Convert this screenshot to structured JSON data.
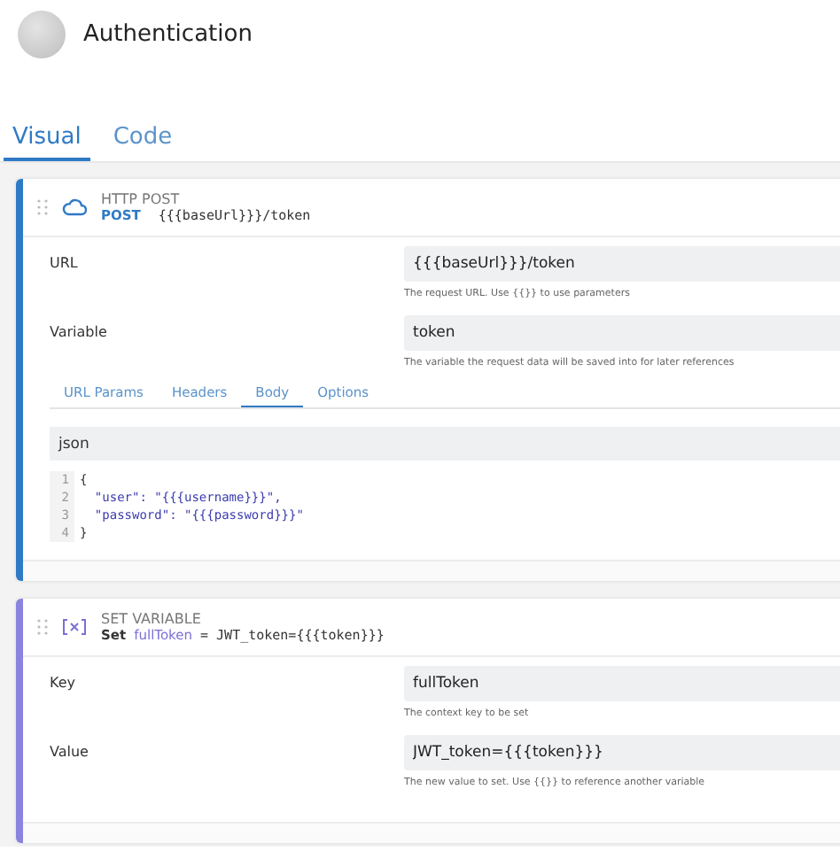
{
  "header": {
    "title": "Authentication"
  },
  "view_tabs": [
    {
      "label": "Visual",
      "selected": true
    },
    {
      "label": "Code",
      "selected": false
    }
  ],
  "steps": [
    {
      "kind": "http",
      "type_label": "HTTP POST",
      "summary": {
        "method": "POST",
        "path": "{{{baseUrl}}}/token"
      },
      "fields": [
        {
          "label": "URL",
          "value": "{{{baseUrl}}}/token",
          "hint": "The request URL. Use {{}} to use parameters"
        },
        {
          "label": "Variable",
          "value": "token",
          "hint": "The variable the request data will be saved into for later references"
        }
      ],
      "request_tabs": [
        {
          "label": "URL Params",
          "selected": false
        },
        {
          "label": "Headers",
          "selected": false
        },
        {
          "label": "Body",
          "selected": true
        },
        {
          "label": "Options",
          "selected": false
        }
      ],
      "body": {
        "format": "json",
        "lines": [
          {
            "number": "1",
            "text": "{",
            "kind": "brace"
          },
          {
            "number": "2",
            "text": "  \"user\": \"{{{username}}}\",",
            "kind": "string"
          },
          {
            "number": "3",
            "text": "  \"password\": \"{{{password}}}\"",
            "kind": "string"
          },
          {
            "number": "4",
            "text": "}",
            "kind": "brace"
          }
        ]
      }
    },
    {
      "kind": "set_variable",
      "type_label": "SET VARIABLE",
      "summary": {
        "verb": "Set",
        "key": "fullToken",
        "operator": "=",
        "value": "JWT_token={{{token}}}"
      },
      "fields": [
        {
          "label": "Key",
          "value": "fullToken",
          "hint": "The context key to be set"
        },
        {
          "label": "Value",
          "value": "JWT_token={{{token}}}",
          "hint": "The new value to set. Use {{}} to reference another variable"
        }
      ]
    }
  ]
}
